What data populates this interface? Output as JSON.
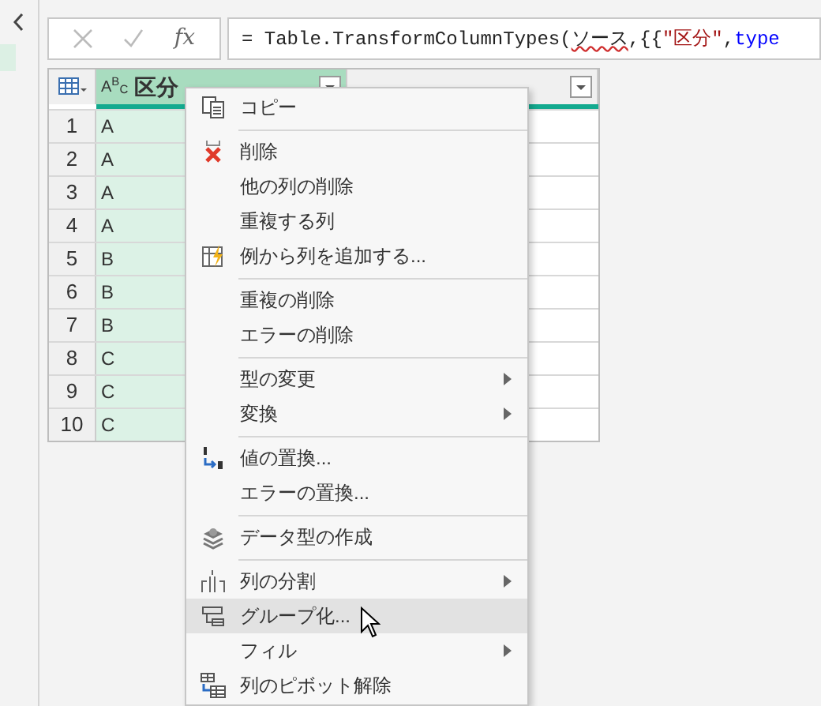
{
  "formula_bar": {
    "function_label": "fx",
    "formula": [
      {
        "kind": "plain",
        "text": "= Table.TransformColumnTypes("
      },
      {
        "kind": "error",
        "text": "ソース"
      },
      {
        "kind": "plain",
        "text": ",{{"
      },
      {
        "kind": "string",
        "text": "\"区分\""
      },
      {
        "kind": "plain",
        "text": ", "
      },
      {
        "kind": "keyword",
        "text": "type"
      }
    ]
  },
  "table": {
    "columns": [
      {
        "type": "A$^{B}$$_{C}$",
        "name": "区分",
        "selected": true
      },
      {
        "selected": false
      }
    ],
    "rows": [
      {
        "index": "1",
        "value": "A"
      },
      {
        "index": "2",
        "value": "A"
      },
      {
        "index": "3",
        "value": "A"
      },
      {
        "index": "4",
        "value": "A"
      },
      {
        "index": "5",
        "value": "B"
      },
      {
        "index": "6",
        "value": "B"
      },
      {
        "index": "7",
        "value": "B"
      },
      {
        "index": "8",
        "value": "C"
      },
      {
        "index": "9",
        "value": "C"
      },
      {
        "index": "10",
        "value": "C"
      }
    ]
  },
  "context_menu": [
    {
      "kind": "copy",
      "label": "コピー",
      "submenu": false,
      "selected": false
    },
    {
      "kind": "separator"
    },
    {
      "kind": "delete",
      "label": "削除",
      "submenu": false,
      "selected": false
    },
    {
      "kind": "plain",
      "label": "他の列の削除",
      "submenu": false,
      "selected": false
    },
    {
      "kind": "plain",
      "label": "重複する列",
      "submenu": false,
      "selected": false
    },
    {
      "kind": "example",
      "label": "例から列を追加する...",
      "submenu": false,
      "selected": false
    },
    {
      "kind": "separator"
    },
    {
      "kind": "plain",
      "label": "重複の削除",
      "submenu": false,
      "selected": false
    },
    {
      "kind": "plain",
      "label": "エラーの削除",
      "submenu": false,
      "selected": false
    },
    {
      "kind": "separator"
    },
    {
      "kind": "plain",
      "label": "型の変更",
      "submenu": true,
      "selected": false
    },
    {
      "kind": "plain",
      "label": "変換",
      "submenu": true,
      "selected": false
    },
    {
      "kind": "separator"
    },
    {
      "kind": "replace",
      "label": "値の置換...",
      "submenu": false,
      "selected": false
    },
    {
      "kind": "plain",
      "label": "エラーの置換...",
      "submenu": false,
      "selected": false
    },
    {
      "kind": "separator"
    },
    {
      "kind": "datatype",
      "label": "データ型の作成",
      "submenu": false,
      "selected": false
    },
    {
      "kind": "separator"
    },
    {
      "kind": "split",
      "label": "列の分割",
      "submenu": true,
      "selected": false
    },
    {
      "kind": "group",
      "label": "グループ化...",
      "submenu": false,
      "selected": true
    },
    {
      "kind": "plain",
      "label": "フィル",
      "submenu": true,
      "selected": false
    },
    {
      "kind": "unpivot",
      "label": "列のピボット解除",
      "submenu": false,
      "selected": false
    }
  ]
}
